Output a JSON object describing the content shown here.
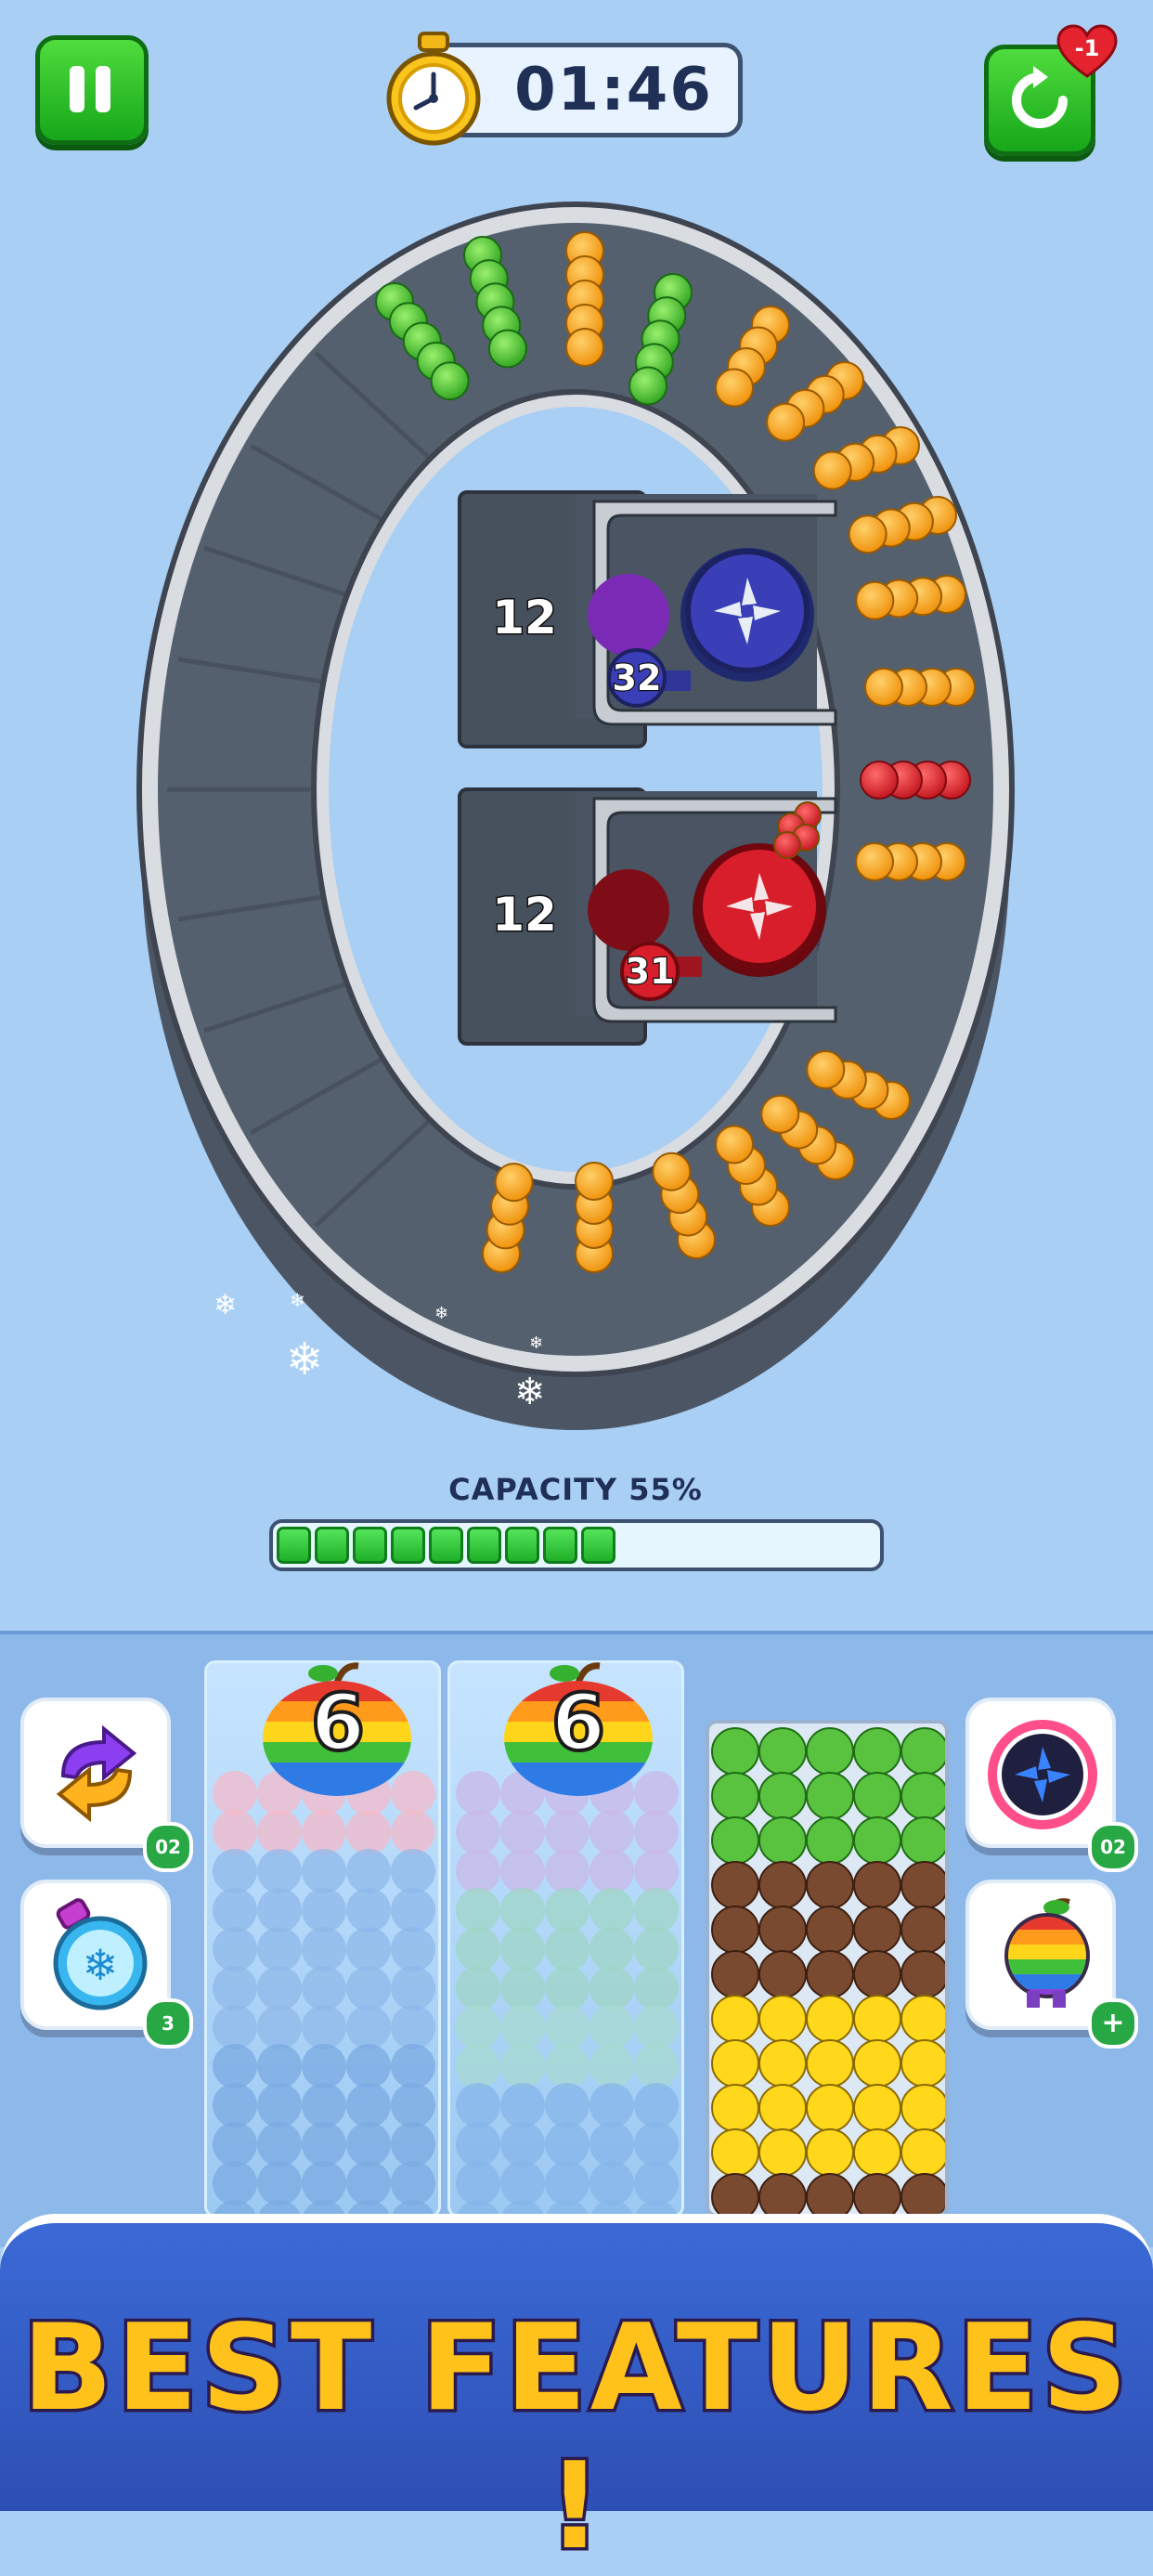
{
  "hud": {
    "timer": "01:46",
    "lives_delta": "-1"
  },
  "board": {
    "blocks": [
      {
        "count": "12",
        "shooter_count": "32",
        "shooter_color": "#3a3fb7",
        "color_name": "blue"
      },
      {
        "count": "12",
        "shooter_count": "31",
        "shooter_color": "#d81e2a",
        "color_name": "red"
      }
    ]
  },
  "capacity": {
    "label": "CAPACITY 55%",
    "percent": 55
  },
  "boosters": {
    "shuffle_count": "02",
    "freeze_count": "3",
    "shuriken_count": "02",
    "rainbow_add": "+"
  },
  "columns": [
    {
      "locked": true,
      "lock_count": "6"
    },
    {
      "locked": true,
      "lock_count": "6"
    },
    {
      "locked": false,
      "fruits": [
        "green-apple",
        "green-apple",
        "green-apple",
        "coconut",
        "coconut",
        "coconut",
        "lemon",
        "lemon",
        "lemon",
        "lemon",
        "coconut"
      ]
    }
  ],
  "banner": {
    "text": "BEST FEATURES !"
  },
  "colors": {
    "background": "#a9cff5",
    "accent_green": "#1fb029",
    "banner_blue": "#3b6ad6",
    "banner_text": "#ffc21b",
    "orange_fruit": "#f9a51b",
    "green_fruit": "#55c83a",
    "red_fruit": "#e0262e"
  }
}
